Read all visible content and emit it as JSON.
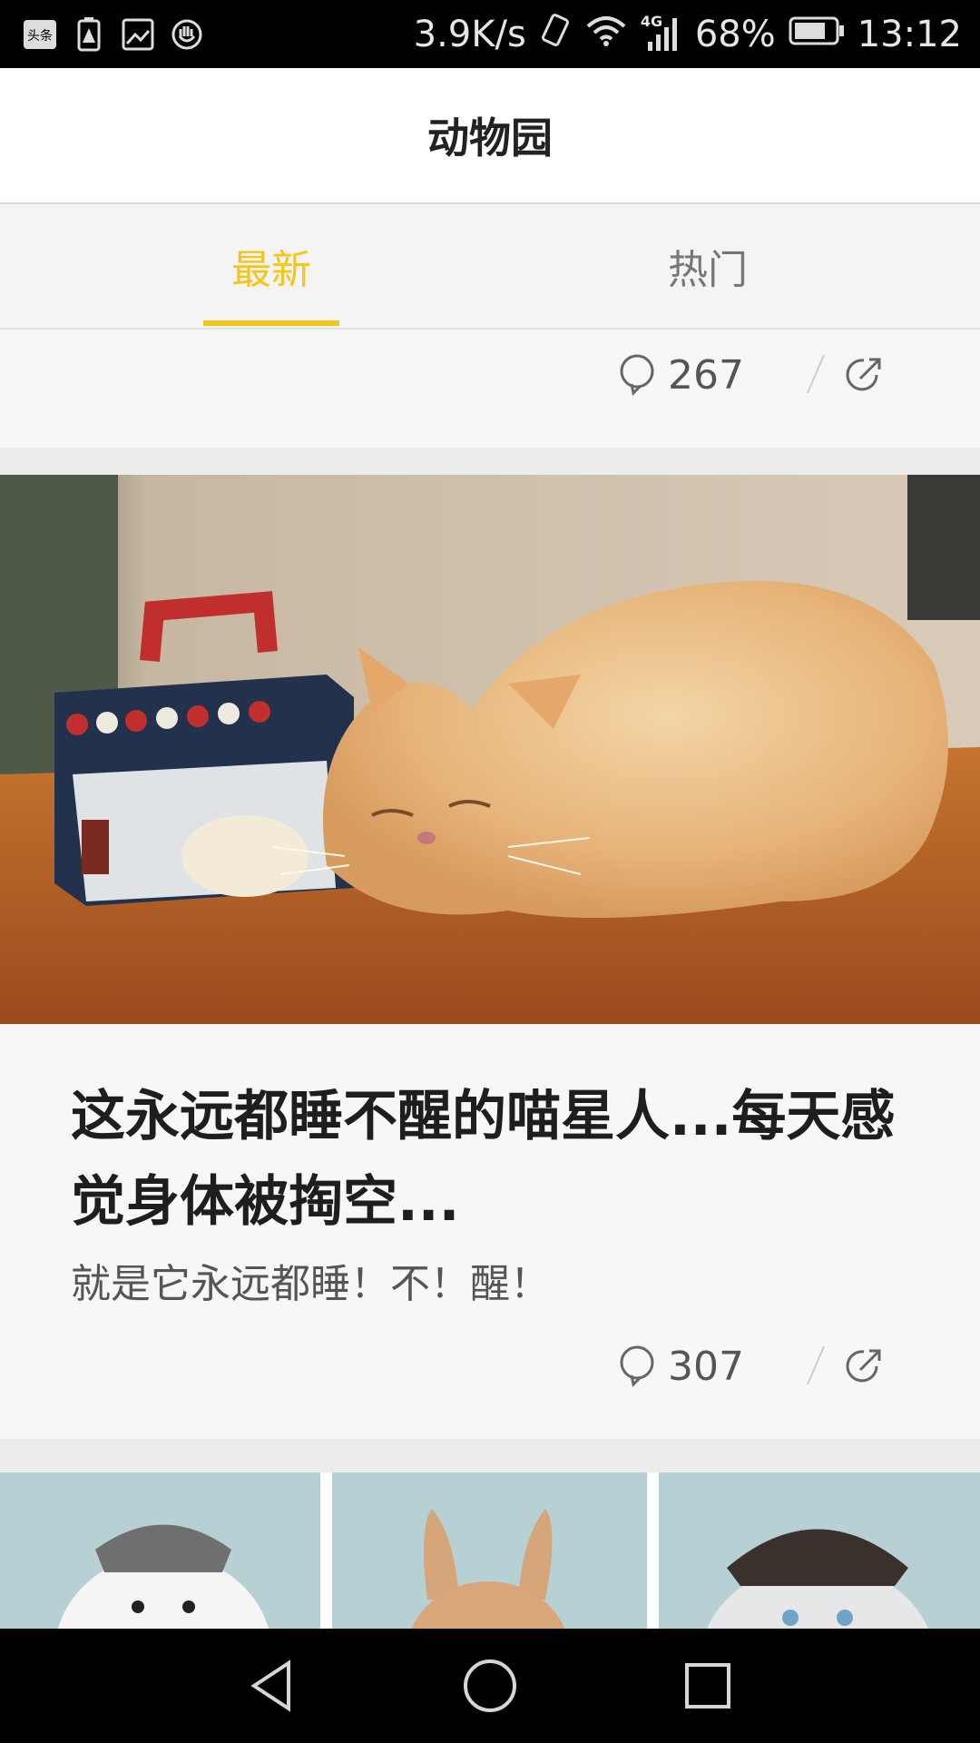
{
  "status_bar": {
    "network_speed": "3.9K/s",
    "network_type": "4G",
    "battery": "68%",
    "time": "13:12",
    "left_icons": [
      "toutiao-icon",
      "battery-alert-icon",
      "image-icon",
      "hand-icon"
    ]
  },
  "header": {
    "title": "动物园"
  },
  "tabs": [
    {
      "label": "最新",
      "active": true
    },
    {
      "label": "热门",
      "active": false
    }
  ],
  "feed": {
    "card_top": {
      "comment_count": "267"
    },
    "card_main": {
      "title": "这永远都睡不醒的喵星人...每天感觉身体被掏空...",
      "subtitle": "就是它永远都睡！不！醒！",
      "comment_count": "307"
    }
  },
  "colors": {
    "accent": "#f5c518"
  }
}
